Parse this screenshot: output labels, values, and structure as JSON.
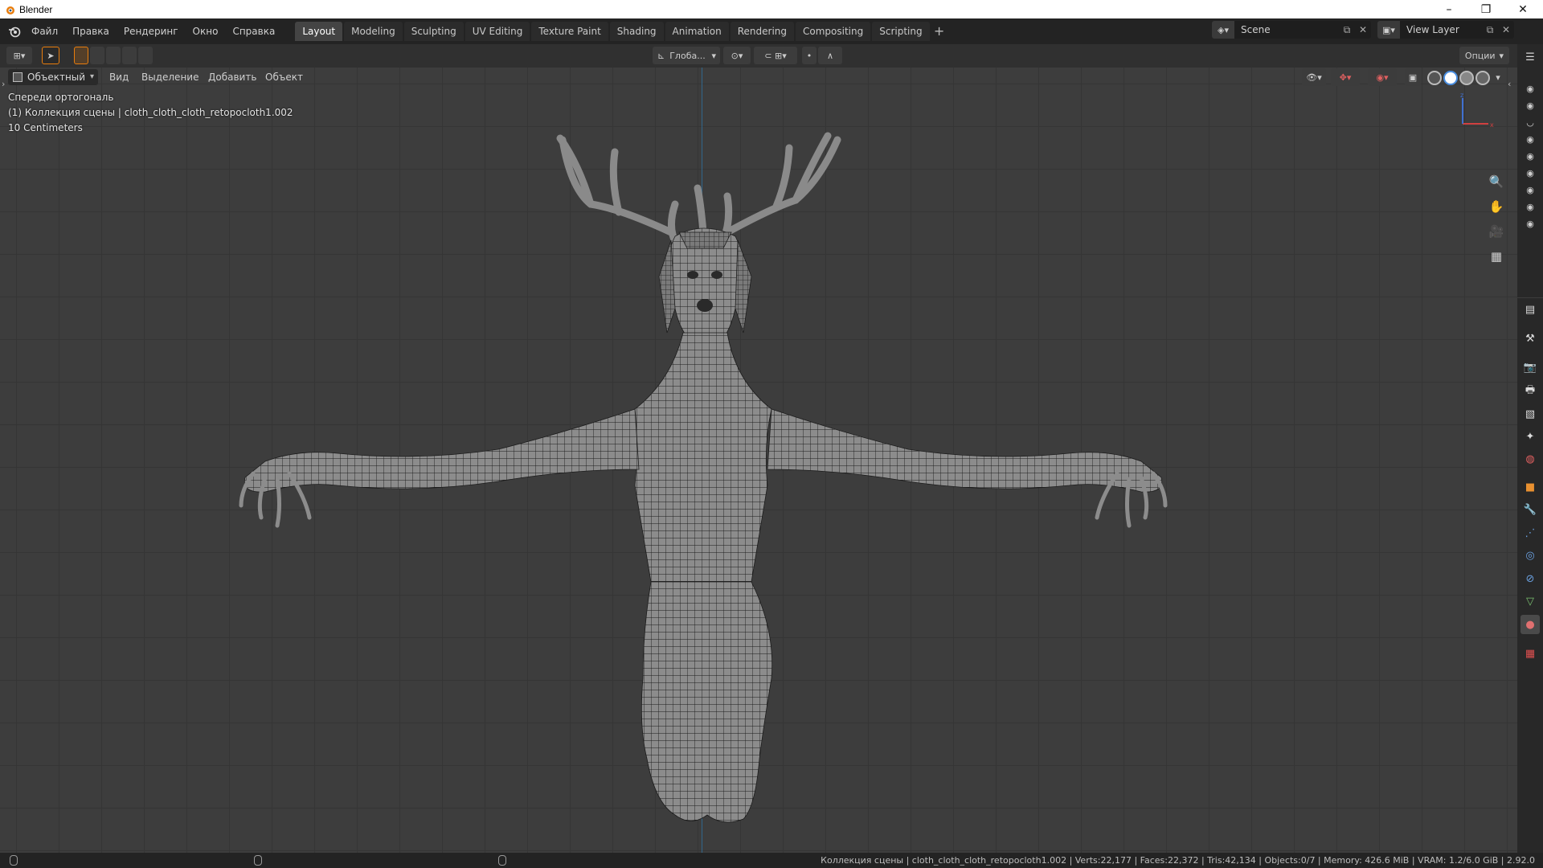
{
  "window": {
    "title": "Blender",
    "minimize": "–",
    "maximize": "❐",
    "close": "✕"
  },
  "menus": [
    "Файл",
    "Правка",
    "Рендеринг",
    "Окно",
    "Справка"
  ],
  "workspaces": [
    "Layout",
    "Modeling",
    "Sculpting",
    "UV Editing",
    "Texture Paint",
    "Shading",
    "Animation",
    "Rendering",
    "Compositing",
    "Scripting"
  ],
  "active_workspace": "Layout",
  "add_workspace": "+",
  "scene": {
    "label": "Scene"
  },
  "view_layer": {
    "label": "View Layer"
  },
  "toolheader": {
    "orientation": "Глоба...",
    "options": "Опции"
  },
  "viewport_header": {
    "mode": "Объектный",
    "menus": [
      "Вид",
      "Выделение",
      "Добавить",
      "Объект"
    ]
  },
  "overlay": {
    "view_name": "Спереди ортогональ",
    "collection": "(1) Коллекция сцены | cloth_cloth_cloth_retopocloth1.002",
    "scale": "10 Centimeters"
  },
  "navigation_icons": [
    "zoom-icon",
    "hand-pan-icon",
    "camera-icon",
    "grid-icon"
  ],
  "statusbar": {
    "info": "Коллекция сцены | cloth_cloth_cloth_retopocloth1.002 | Verts:22,177 | Faces:22,372 | Tris:42,134 | Objects:0/7 | Memory: 426.6 MiB | VRAM: 1.2/6.0 GiB | 2.92.0"
  },
  "colors": {
    "accent_tab": "#444444",
    "header_bg": "#232323",
    "viewport_bg": "#3d3d3d",
    "axis_blue": "#2f6d99",
    "selected_orange": "#e87d0d"
  }
}
